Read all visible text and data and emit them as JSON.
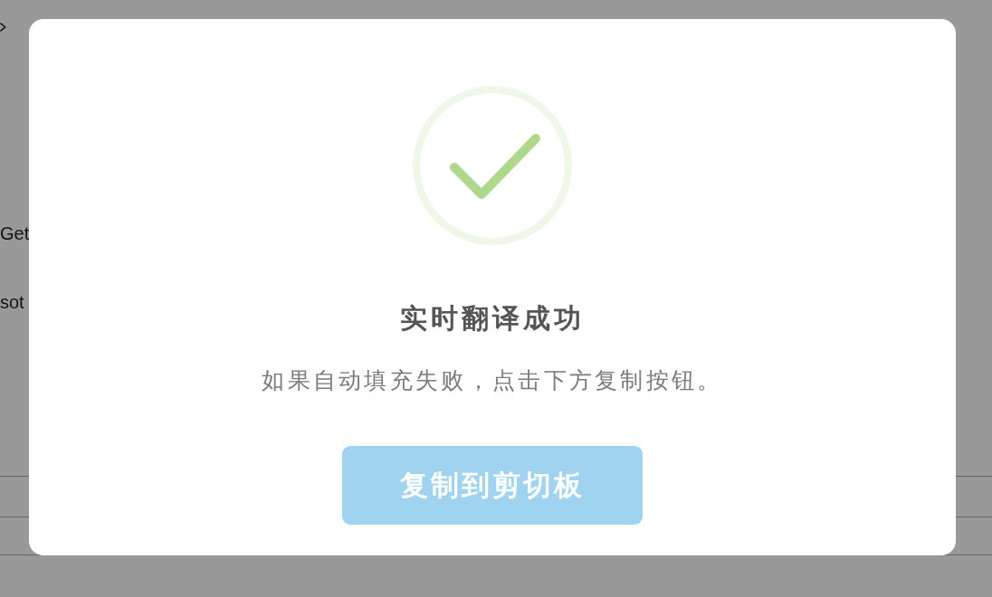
{
  "background_page": {
    "texts": [
      "Get",
      "sot"
    ]
  },
  "dialog": {
    "title": "实时翻译成功",
    "message": "如果自动填充失败，点击下方复制按钮。",
    "button": "复制到剪切板"
  }
}
